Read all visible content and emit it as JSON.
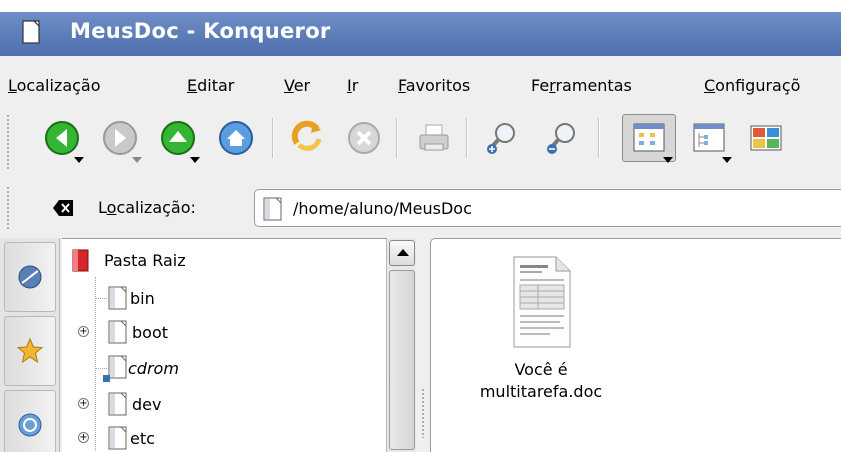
{
  "window": {
    "title": "MeusDoc - Konqueror"
  },
  "menubar": {
    "items": [
      {
        "pre": "",
        "ul": "L",
        "post": "ocalização"
      },
      {
        "pre": "",
        "ul": "E",
        "post": "ditar"
      },
      {
        "pre": "",
        "ul": "V",
        "post": "er"
      },
      {
        "pre": "",
        "ul": "I",
        "post": "r"
      },
      {
        "pre": "",
        "ul": "F",
        "post": "avoritos"
      },
      {
        "pre": "Fe",
        "ul": "r",
        "post": "ramentas"
      },
      {
        "pre": "",
        "ul": "C",
        "post": "onfiguraçõ"
      }
    ]
  },
  "toolbar": {
    "icons": [
      "back-icon",
      "forward-icon",
      "up-icon",
      "home-icon",
      "reload-icon",
      "stop-icon",
      "print-icon",
      "zoom-in-icon",
      "zoom-out-icon",
      "icon-view-icon",
      "tree-view-icon",
      "multi-column-view-icon"
    ]
  },
  "location": {
    "label_pre": "L",
    "label_ul": "o",
    "label_post": "calização:",
    "path": "/home/aluno/MeusDoc"
  },
  "tree": {
    "root": "Pasta Raiz",
    "items": [
      {
        "label": "bin",
        "expandable": false,
        "italic": false
      },
      {
        "label": "boot",
        "expandable": true,
        "italic": false
      },
      {
        "label": "cdrom",
        "expandable": false,
        "italic": true
      },
      {
        "label": "dev",
        "expandable": true,
        "italic": false
      },
      {
        "label": "etc",
        "expandable": true,
        "italic": false
      }
    ]
  },
  "files": [
    {
      "name_line1": "Você é",
      "name_line2": "multitarefa.doc"
    }
  ],
  "colors": {
    "titlebar_top": "#6f8ec6",
    "titlebar_bottom": "#4e6fae",
    "nav_green": "#2fae2f",
    "home_blue": "#4d8fd6"
  }
}
